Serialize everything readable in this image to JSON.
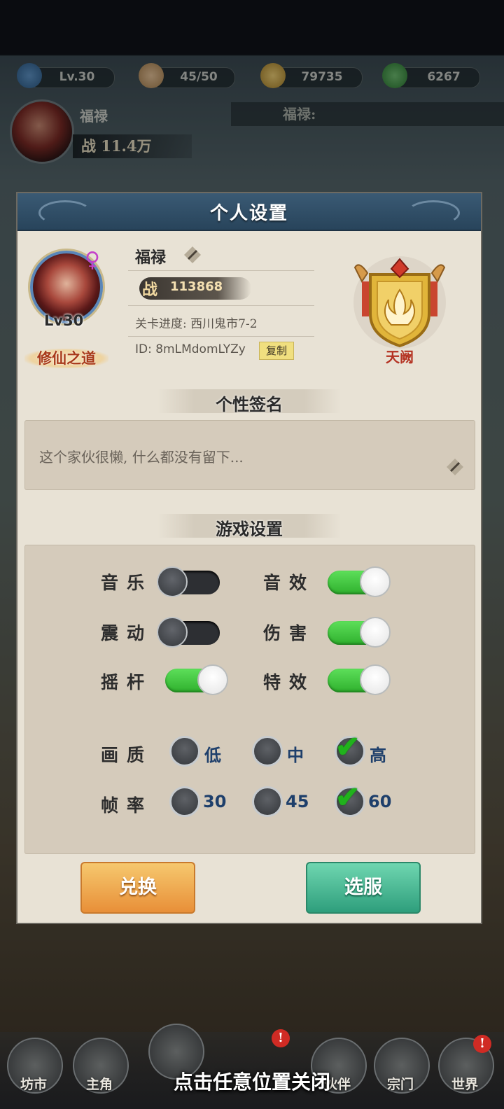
{
  "resources": [
    {
      "icon": "level-dragon-icon",
      "value": "Lv.30"
    },
    {
      "icon": "bun-stamina-icon",
      "value": "45/50"
    },
    {
      "icon": "copper-coin-icon",
      "value": "79735"
    },
    {
      "icon": "jade-gem-icon",
      "value": "6267"
    }
  ],
  "header": {
    "player_name": "福禄",
    "power": "战 11.4万",
    "chat_prefix": "福禄:"
  },
  "panel": {
    "title": "个人设置",
    "profile": {
      "name": "福禄",
      "gender_symbol": "♀",
      "level": "Lv30",
      "title_badge": "修仙之道",
      "power_icon": "战",
      "power_value": "113868",
      "stage": "关卡进度: 西川鬼市7-2",
      "id": "ID: 8mLMdomLYZy",
      "copy_label": "复制",
      "rank_name": "天阙"
    },
    "signature": {
      "heading": "个性签名",
      "text": "这个家伙很懒, 什么都没有留下..."
    },
    "settings": {
      "heading": "游戏设置",
      "toggles": [
        {
          "label": "音乐",
          "on": false
        },
        {
          "label": "音效",
          "on": true
        },
        {
          "label": "震动",
          "on": false
        },
        {
          "label": "伤害",
          "on": true
        },
        {
          "label": "摇杆",
          "on": true
        },
        {
          "label": "特效",
          "on": true
        }
      ],
      "quality": {
        "label": "画质",
        "options": [
          "低",
          "中",
          "高"
        ],
        "selected": "高"
      },
      "framerate": {
        "label": "帧率",
        "options": [
          "30",
          "45",
          "60"
        ],
        "selected": "60"
      }
    },
    "buttons": {
      "exchange": "兑换",
      "select_server": "选服"
    }
  },
  "bottom_nav": [
    "坊市",
    "主角",
    "伙伴",
    "宗门",
    "世界"
  ],
  "close_hint": "点击任意位置关闭",
  "colors": {
    "accent_title": "#28445b",
    "toggle_on": "#2fb02d",
    "rank_red": "#b43222"
  }
}
